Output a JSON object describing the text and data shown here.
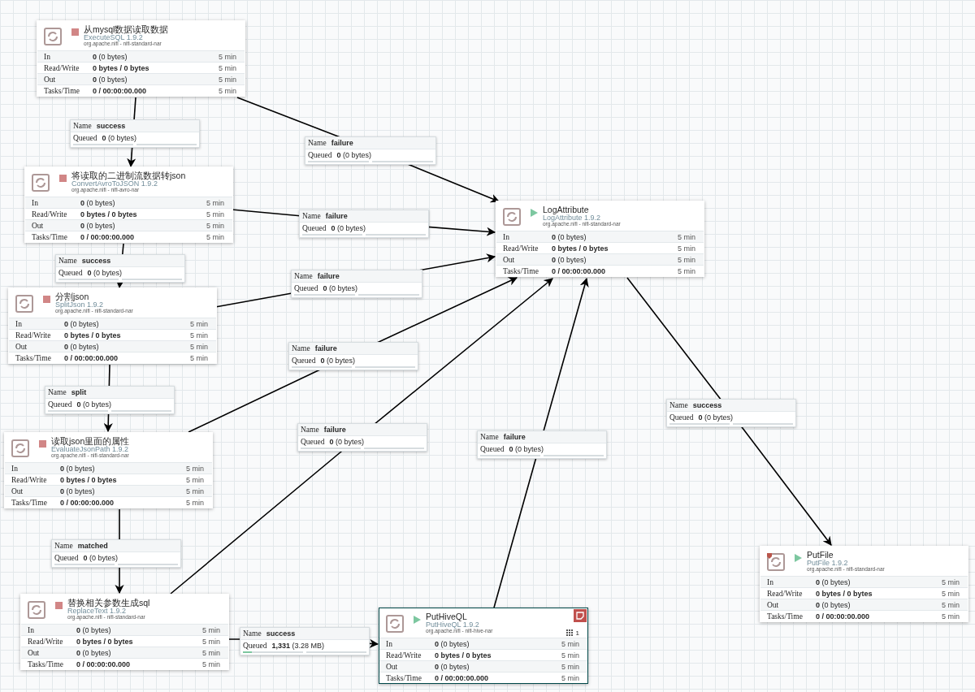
{
  "processors": [
    {
      "name": "从mysql数据读取数据",
      "type": "ExecuteSQL 1.9.2",
      "bundle": "org.apache.nifi - nifi-standard-nar",
      "running": false,
      "selected": false,
      "bulletin": false,
      "warning": false,
      "stats": [
        {
          "kind": "count",
          "label": "In",
          "value": "**0** (0 bytes)",
          "period": "5 min"
        },
        {
          "kind": "total",
          "label": "Read/Write",
          "value": "0 bytes / 0 bytes",
          "period": "5 min"
        },
        {
          "kind": "count",
          "label": "Out",
          "value": "**0** (0 bytes)",
          "period": "5 min"
        },
        {
          "kind": "total",
          "label": "Tasks/Time",
          "value": "0 / 00:00:00.000",
          "period": "5 min"
        }
      ]
    },
    {
      "name": "将读取的二进制流数据转json",
      "type": "ConvertAvroToJSON 1.9.2",
      "bundle": "org.apache.nifi - nifi-avro-nar",
      "running": false,
      "selected": false,
      "bulletin": false,
      "warning": false,
      "stats": [
        {
          "kind": "count",
          "label": "In",
          "value": "**0** (0 bytes)",
          "period": "5 min"
        },
        {
          "kind": "total",
          "label": "Read/Write",
          "value": "0 bytes / 0 bytes",
          "period": "5 min"
        },
        {
          "kind": "count",
          "label": "Out",
          "value": "**0** (0 bytes)",
          "period": "5 min"
        },
        {
          "kind": "total",
          "label": "Tasks/Time",
          "value": "0 / 00:00:00.000",
          "period": "5 min"
        }
      ]
    },
    {
      "name": "分割json",
      "type": "SplitJson 1.9.2",
      "bundle": "org.apache.nifi - nifi-standard-nar",
      "running": false,
      "selected": false,
      "bulletin": false,
      "warning": false,
      "stats": [
        {
          "kind": "count",
          "label": "In",
          "value": "**0** (0 bytes)",
          "period": "5 min"
        },
        {
          "kind": "total",
          "label": "Read/Write",
          "value": "0 bytes / 0 bytes",
          "period": "5 min"
        },
        {
          "kind": "count",
          "label": "Out",
          "value": "**0** (0 bytes)",
          "period": "5 min"
        },
        {
          "kind": "total",
          "label": "Tasks/Time",
          "value": "0 / 00:00:00.000",
          "period": "5 min"
        }
      ]
    },
    {
      "name": "读取json里面的属性",
      "type": "EvaluateJsonPath 1.9.2",
      "bundle": "org.apache.nifi - nifi-standard-nar",
      "running": false,
      "selected": false,
      "bulletin": false,
      "warning": false,
      "stats": [
        {
          "kind": "count",
          "label": "In",
          "value": "**0** (0 bytes)",
          "period": "5 min"
        },
        {
          "kind": "total",
          "label": "Read/Write",
          "value": "0 bytes / 0 bytes",
          "period": "5 min"
        },
        {
          "kind": "count",
          "label": "Out",
          "value": "**0** (0 bytes)",
          "period": "5 min"
        },
        {
          "kind": "total",
          "label": "Tasks/Time",
          "value": "0 / 00:00:00.000",
          "period": "5 min"
        }
      ]
    },
    {
      "name": "替换相关参数生成sql",
      "type": "ReplaceText 1.9.2",
      "bundle": "org.apache.nifi - nifi-standard-nar",
      "running": false,
      "selected": false,
      "bulletin": false,
      "warning": false,
      "stats": [
        {
          "kind": "count",
          "label": "In",
          "value": "**0** (0 bytes)",
          "period": "5 min"
        },
        {
          "kind": "total",
          "label": "Read/Write",
          "value": "0 bytes / 0 bytes",
          "period": "5 min"
        },
        {
          "kind": "count",
          "label": "Out",
          "value": "**0** (0 bytes)",
          "period": "5 min"
        },
        {
          "kind": "total",
          "label": "Tasks/Time",
          "value": "0 / 00:00:00.000",
          "period": "5 min"
        }
      ]
    },
    {
      "name": "PutHiveQL",
      "type": "PutHiveQL 1.9.2",
      "bundle": "org.apache.nifi - nifi-hive-nar",
      "running": true,
      "selected": true,
      "bulletin": true,
      "warning": false,
      "threads": "1",
      "stats": [
        {
          "kind": "count",
          "label": "In",
          "value": "**0** (0 bytes)",
          "period": "5 min"
        },
        {
          "kind": "total",
          "label": "Read/Write",
          "value": "0 bytes / 0 bytes",
          "period": "5 min"
        },
        {
          "kind": "count",
          "label": "Out",
          "value": "**0** (0 bytes)",
          "period": "5 min"
        },
        {
          "kind": "total",
          "label": "Tasks/Time",
          "value": "0 / 00:00:00.000",
          "period": "5 min"
        }
      ]
    },
    {
      "name": "LogAttribute",
      "type": "LogAttribute 1.9.2",
      "bundle": "org.apache.nifi - nifi-standard-nar",
      "running": true,
      "selected": false,
      "bulletin": false,
      "warning": false,
      "stats": [
        {
          "kind": "count",
          "label": "In",
          "value": "**0** (0 bytes)",
          "period": "5 min"
        },
        {
          "kind": "total",
          "label": "Read/Write",
          "value": "0 bytes / 0 bytes",
          "period": "5 min"
        },
        {
          "kind": "count",
          "label": "Out",
          "value": "**0** (0 bytes)",
          "period": "5 min"
        },
        {
          "kind": "total",
          "label": "Tasks/Time",
          "value": "0 / 00:00:00.000",
          "period": "5 min"
        }
      ]
    },
    {
      "name": "PutFile",
      "type": "PutFile 1.9.2",
      "bundle": "org.apache.nifi - nifi-standard-nar",
      "running": true,
      "selected": false,
      "bulletin": false,
      "warning": true,
      "stats": [
        {
          "kind": "count",
          "label": "In",
          "value": "**0** (0 bytes)",
          "period": "5 min"
        },
        {
          "kind": "total",
          "label": "Read/Write",
          "value": "0 bytes / 0 bytes",
          "period": "5 min"
        },
        {
          "kind": "count",
          "label": "Out",
          "value": "**0** (0 bytes)",
          "period": "5 min"
        },
        {
          "kind": "total",
          "label": "Tasks/Time",
          "value": "0 / 00:00:00.000",
          "period": "5 min"
        }
      ]
    }
  ],
  "connections": [
    {
      "name_label": "Name",
      "relationship": "success",
      "queued_label": "Queued",
      "queued": "**0** (0 bytes)"
    },
    {
      "name_label": "Name",
      "relationship": "failure",
      "queued_label": "Queued",
      "queued": "**0** (0 bytes)"
    },
    {
      "name_label": "Name",
      "relationship": "failure",
      "queued_label": "Queued",
      "queued": "**0** (0 bytes)"
    },
    {
      "name_label": "Name",
      "relationship": "success",
      "queued_label": "Queued",
      "queued": "**0** (0 bytes)"
    },
    {
      "name_label": "Name",
      "relationship": "failure",
      "queued_label": "Queued",
      "queued": "**0** (0 bytes)"
    },
    {
      "name_label": "Name",
      "relationship": "failure",
      "queued_label": "Queued",
      "queued": "**0** (0 bytes)"
    },
    {
      "name_label": "Name",
      "relationship": "split",
      "queued_label": "Queued",
      "queued": "**0** (0 bytes)"
    },
    {
      "name_label": "Name",
      "relationship": "failure",
      "queued_label": "Queued",
      "queued": "**0** (0 bytes)"
    },
    {
      "name_label": "Name",
      "relationship": "failure",
      "queued_label": "Queued",
      "queued": "**0** (0 bytes)"
    },
    {
      "name_label": "Name",
      "relationship": "success",
      "queued_label": "Queued",
      "queued": "**0** (0 bytes)"
    },
    {
      "name_label": "Name",
      "relationship": "matched",
      "queued_label": "Queued",
      "queued": "**0** (0 bytes)"
    },
    {
      "name_label": "Name",
      "relationship": "success",
      "queued_label": "Queued",
      "queued": "**1,331** (3.28 MB)",
      "level": 0.15
    }
  ]
}
